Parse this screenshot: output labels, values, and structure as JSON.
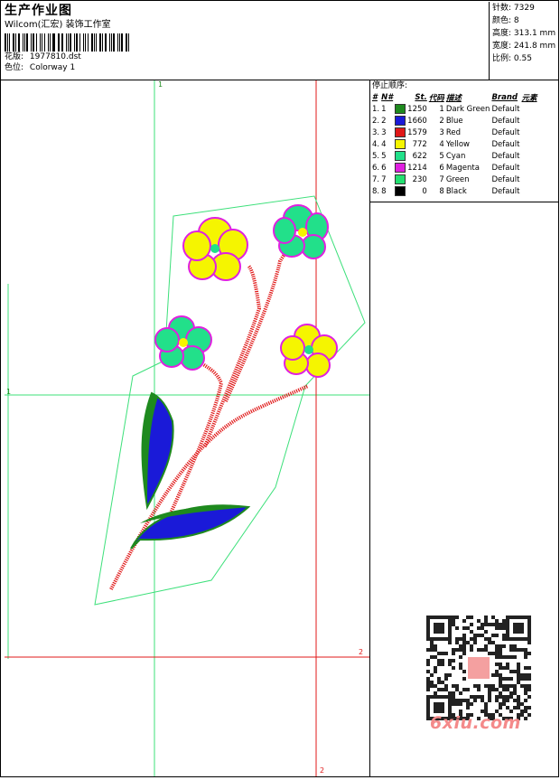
{
  "header": {
    "title": "生产作业图",
    "company": "Wilcom(汇宏) 装饰工作室",
    "pattern_label": "花版:",
    "pattern_value": "1977810.dst",
    "color_label": "色位:",
    "color_value": "Colorway 1"
  },
  "stats": [
    {
      "label": "针数",
      "value": "7329"
    },
    {
      "label": "颜色",
      "value": "8"
    },
    {
      "label": "高度",
      "value": "313.1 mm"
    },
    {
      "label": "宽度",
      "value": "241.8 mm"
    },
    {
      "label": "比例",
      "value": "0.55"
    }
  ],
  "stop_sequence": {
    "heading": "停止顺序:",
    "columns": [
      "#",
      "N#",
      "St.",
      "代码",
      "描述",
      "Brand",
      "元素"
    ],
    "rows": [
      {
        "idx": "1.",
        "n": "1",
        "color": "#1e8a1e",
        "st": "1250",
        "code": "1",
        "desc": "Dark Green",
        "brand": "Default"
      },
      {
        "idx": "2.",
        "n": "2",
        "color": "#1a1ad8",
        "st": "1660",
        "code": "2",
        "desc": "Blue",
        "brand": "Default"
      },
      {
        "idx": "3.",
        "n": "3",
        "color": "#e01818",
        "st": "1579",
        "code": "3",
        "desc": "Red",
        "brand": "Default"
      },
      {
        "idx": "4.",
        "n": "4",
        "color": "#f5f500",
        "st": "772",
        "code": "4",
        "desc": "Yellow",
        "brand": "Default"
      },
      {
        "idx": "5.",
        "n": "5",
        "color": "#22e08a",
        "st": "622",
        "code": "5",
        "desc": "Cyan",
        "brand": "Default"
      },
      {
        "idx": "6.",
        "n": "6",
        "color": "#e020e0",
        "st": "1214",
        "code": "6",
        "desc": "Magenta",
        "brand": "Default"
      },
      {
        "idx": "7.",
        "n": "7",
        "color": "#22e070",
        "st": "230",
        "code": "7",
        "desc": "Green",
        "brand": "Default"
      },
      {
        "idx": "8.",
        "n": "8",
        "color": "#000000",
        "st": "0",
        "code": "8",
        "desc": "Black",
        "brand": "Default"
      }
    ]
  },
  "design_marks": {
    "green_top": "1",
    "green_left": "1",
    "red_right": "2",
    "red_bottom": "2"
  },
  "watermark": "6xiu.com"
}
